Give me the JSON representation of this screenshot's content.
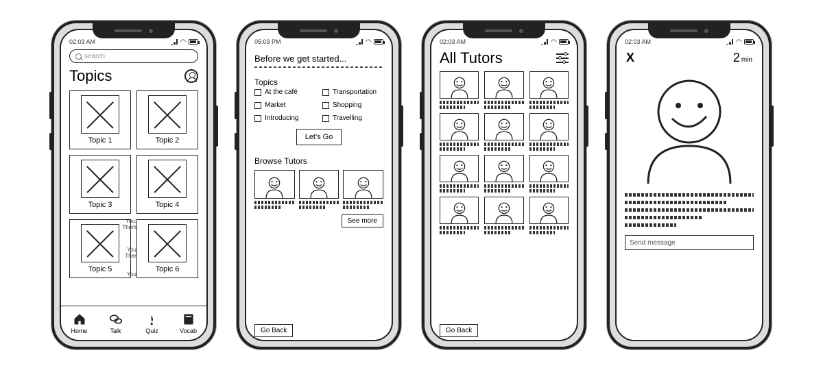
{
  "status": {
    "time1": "02:03 AM",
    "time2": "05:03 PM",
    "time3": "02:03 AM",
    "time4": "02:03 AM"
  },
  "screen1": {
    "search_placeholder": "search",
    "title": "Topics",
    "topics": [
      "Topic 1",
      "Topic 2",
      "Topic 3",
      "Topic 4",
      "Topic 5",
      "Topic 6"
    ],
    "chat_labels": [
      "You:",
      "Them",
      "You",
      "Ther",
      "You"
    ],
    "tabs": {
      "home": "Home",
      "talk": "Talk",
      "quiz": "Quiz",
      "vocab": "Vocab"
    }
  },
  "screen2": {
    "pre_title": "Before we get started...",
    "section_topics": "Topics",
    "checks_left": [
      "At the café",
      "Market",
      "Introducing"
    ],
    "checks_right": [
      "Transportation",
      "Shopping",
      "Travelling"
    ],
    "letsgo": "Let's Go",
    "browse": "Browse Tutors",
    "seemore": "See more",
    "goback": "Go Back"
  },
  "screen3": {
    "title": "All Tutors",
    "goback": "Go Back"
  },
  "screen4": {
    "close": "X",
    "duration_num": "2",
    "duration_unit": "min",
    "msg_placeholder": "Send message"
  }
}
